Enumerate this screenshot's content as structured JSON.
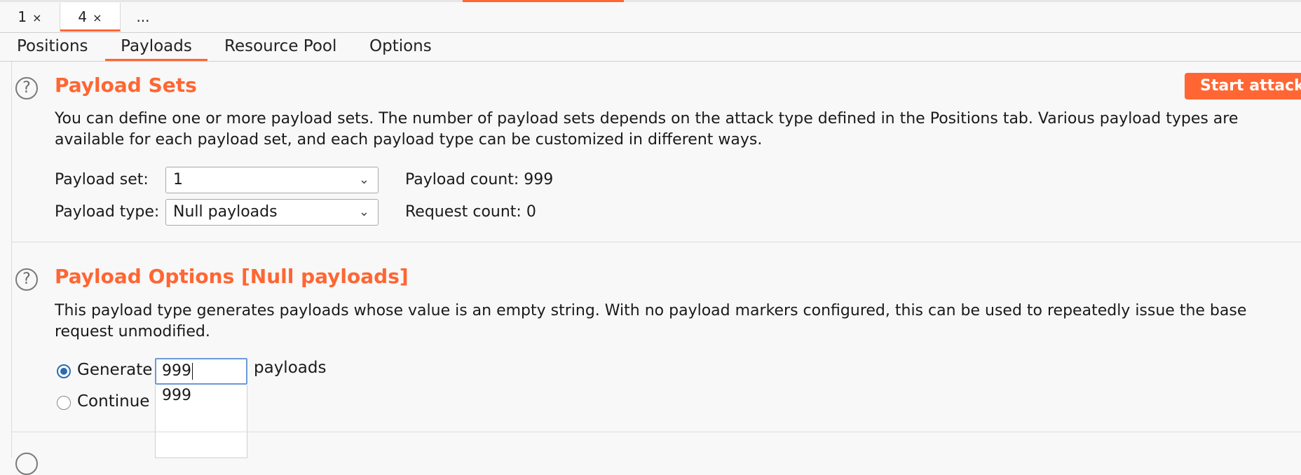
{
  "request_tabs": [
    {
      "label": "1",
      "close": "×"
    },
    {
      "label": "4",
      "close": "×"
    },
    {
      "label": "..."
    }
  ],
  "sub_tabs": [
    "Positions",
    "Payloads",
    "Resource Pool",
    "Options"
  ],
  "payload_sets": {
    "title": "Payload Sets",
    "description": "You can define one or more payload sets. The number of payload sets depends on the attack type defined in the Positions tab. Various payload types are available for each payload set, and each payload type can be customized in different ways.",
    "start_button": "Start attack",
    "set_label": "Payload set:",
    "set_value": "1",
    "type_label": "Payload type:",
    "type_value": "Null payloads",
    "payload_count": "Payload count: 999",
    "request_count": "Request count: 0"
  },
  "payload_options": {
    "title": "Payload Options [Null payloads]",
    "description": "This payload type generates payloads whose value is an empty string. With no payload markers configured, this can be used to repeatedly issue the base request unmodified.",
    "generate_label": "Generate",
    "generate_value": "999",
    "payloads_suffix": "payloads",
    "continue_label": "Continue i",
    "autocomplete_option": "999"
  },
  "help_glyph": "?",
  "chevron_glyph": "⌄",
  "colors": {
    "accent": "#ff6633",
    "radio": "#2b6cb0"
  }
}
